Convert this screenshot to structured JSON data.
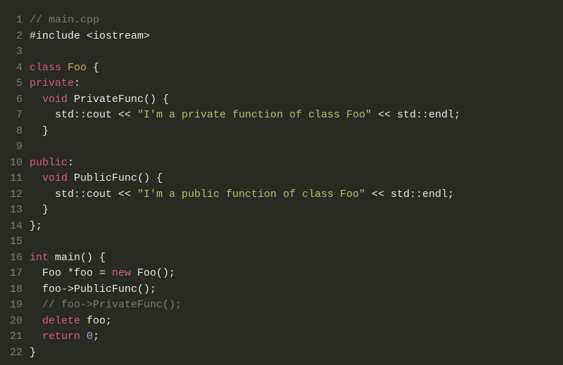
{
  "code": {
    "language": "cpp",
    "filename": "main.cpp",
    "lines": [
      {
        "n": 1,
        "tokens": [
          {
            "cls": "tok-comment",
            "t": "// main.cpp"
          }
        ]
      },
      {
        "n": 2,
        "tokens": [
          {
            "cls": "tok-preproc",
            "t": "#include "
          },
          {
            "cls": "tok-preproc",
            "t": "<iostream>"
          }
        ]
      },
      {
        "n": 3,
        "tokens": []
      },
      {
        "n": 4,
        "tokens": [
          {
            "cls": "tok-keyword",
            "t": "class "
          },
          {
            "cls": "tok-classname",
            "t": "Foo"
          },
          {
            "cls": "tok-punct",
            "t": " {"
          }
        ]
      },
      {
        "n": 5,
        "tokens": [
          {
            "cls": "tok-keyword",
            "t": "private"
          },
          {
            "cls": "tok-punct",
            "t": ":"
          }
        ]
      },
      {
        "n": 6,
        "tokens": [
          {
            "cls": "tok-punct",
            "t": "  "
          },
          {
            "cls": "tok-type",
            "t": "void"
          },
          {
            "cls": "tok-punct",
            "t": " "
          },
          {
            "cls": "tok-funcname",
            "t": "PrivateFunc"
          },
          {
            "cls": "tok-punct",
            "t": "() {"
          }
        ]
      },
      {
        "n": 7,
        "tokens": [
          {
            "cls": "tok-punct",
            "t": "    std::cout << "
          },
          {
            "cls": "tok-string",
            "t": "\"I'm a private function of class Foo\""
          },
          {
            "cls": "tok-punct",
            "t": " << std::endl;"
          }
        ]
      },
      {
        "n": 8,
        "tokens": [
          {
            "cls": "tok-punct",
            "t": "  }"
          }
        ]
      },
      {
        "n": 9,
        "tokens": []
      },
      {
        "n": 10,
        "tokens": [
          {
            "cls": "tok-keyword",
            "t": "public"
          },
          {
            "cls": "tok-punct",
            "t": ":"
          }
        ]
      },
      {
        "n": 11,
        "tokens": [
          {
            "cls": "tok-punct",
            "t": "  "
          },
          {
            "cls": "tok-type",
            "t": "void"
          },
          {
            "cls": "tok-punct",
            "t": " "
          },
          {
            "cls": "tok-funcname",
            "t": "PublicFunc"
          },
          {
            "cls": "tok-punct",
            "t": "() {"
          }
        ]
      },
      {
        "n": 12,
        "tokens": [
          {
            "cls": "tok-punct",
            "t": "    std::cout << "
          },
          {
            "cls": "tok-string",
            "t": "\"I'm a public function of class Foo\""
          },
          {
            "cls": "tok-punct",
            "t": " << std::endl;"
          }
        ]
      },
      {
        "n": 13,
        "tokens": [
          {
            "cls": "tok-punct",
            "t": "  }"
          }
        ]
      },
      {
        "n": 14,
        "tokens": [
          {
            "cls": "tok-punct",
            "t": "};"
          }
        ]
      },
      {
        "n": 15,
        "tokens": []
      },
      {
        "n": 16,
        "tokens": [
          {
            "cls": "tok-type",
            "t": "int"
          },
          {
            "cls": "tok-punct",
            "t": " "
          },
          {
            "cls": "tok-funcname",
            "t": "main"
          },
          {
            "cls": "tok-punct",
            "t": "() {"
          }
        ]
      },
      {
        "n": 17,
        "tokens": [
          {
            "cls": "tok-punct",
            "t": "  Foo *foo = "
          },
          {
            "cls": "tok-keyword",
            "t": "new"
          },
          {
            "cls": "tok-punct",
            "t": " Foo();"
          }
        ]
      },
      {
        "n": 18,
        "tokens": [
          {
            "cls": "tok-punct",
            "t": "  foo->"
          },
          {
            "cls": "tok-funcname",
            "t": "PublicFunc"
          },
          {
            "cls": "tok-punct",
            "t": "();"
          }
        ]
      },
      {
        "n": 19,
        "tokens": [
          {
            "cls": "tok-punct",
            "t": "  "
          },
          {
            "cls": "tok-comment",
            "t": "// foo->PrivateFunc();"
          }
        ]
      },
      {
        "n": 20,
        "tokens": [
          {
            "cls": "tok-punct",
            "t": "  "
          },
          {
            "cls": "tok-keyword",
            "t": "delete"
          },
          {
            "cls": "tok-punct",
            "t": " foo;"
          }
        ]
      },
      {
        "n": 21,
        "tokens": [
          {
            "cls": "tok-punct",
            "t": "  "
          },
          {
            "cls": "tok-keyword",
            "t": "return"
          },
          {
            "cls": "tok-punct",
            "t": " "
          },
          {
            "cls": "tok-number",
            "t": "0"
          },
          {
            "cls": "tok-punct",
            "t": ";"
          }
        ]
      },
      {
        "n": 22,
        "tokens": [
          {
            "cls": "tok-punct",
            "t": "}"
          }
        ]
      }
    ]
  }
}
